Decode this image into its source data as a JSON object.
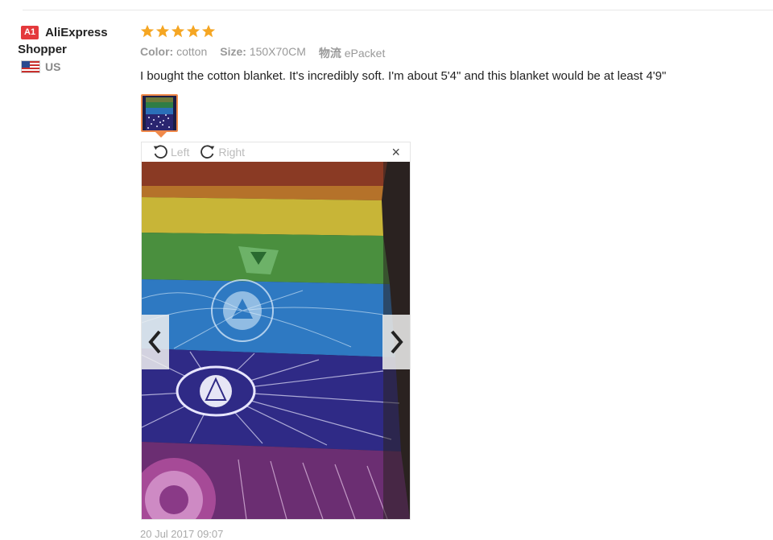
{
  "user": {
    "level_badge": "A1",
    "name_line1": "AliExpress",
    "name_line2": "Shopper",
    "country": "US"
  },
  "review": {
    "rating": 5,
    "color_label": "Color:",
    "color_value": "cotton",
    "size_label": "Size:",
    "size_value": "150X70CM",
    "shipping_label": "物流",
    "shipping_value": "ePacket",
    "text": "I bought the cotton blanket. It's incredibly soft. I'm about 5'4\" and this blanket would be at least 4'9\"",
    "date": "20 Jul 2017 09:07"
  },
  "viewer": {
    "left_label": "Left",
    "right_label": "Right",
    "close_symbol": "×"
  },
  "colors": {
    "star": "#f5a623",
    "badge": "#e4393c",
    "thumb_border": "#f0894a"
  }
}
